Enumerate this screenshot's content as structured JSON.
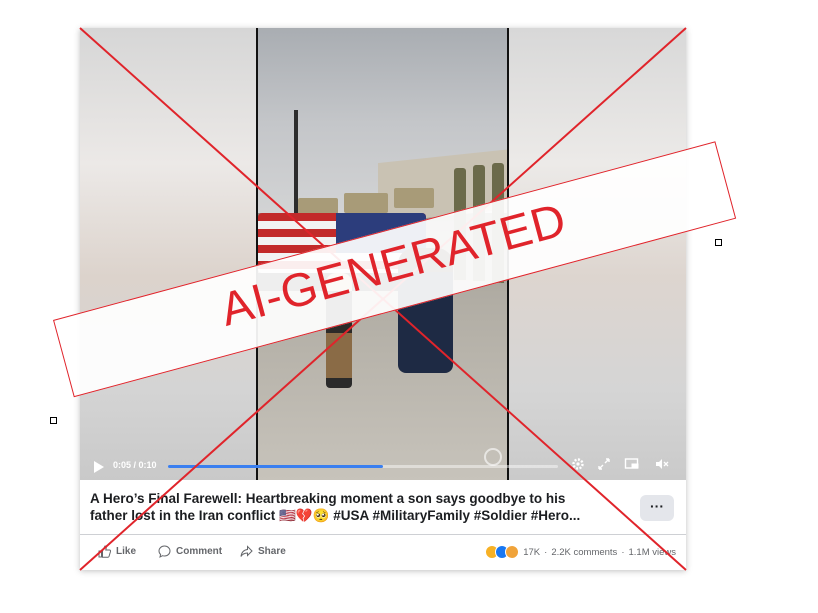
{
  "video": {
    "time": "0:05 / 0:10",
    "progress_fraction": 0.55,
    "icons": [
      "play-icon",
      "settings-icon",
      "fullscreen-icon",
      "pip-icon",
      "mute-icon"
    ]
  },
  "post": {
    "caption_line1": "A Hero’s Final Farewell: Heartbreaking moment a son says goodbye to his",
    "caption_line2": "father lost in the Iran conflict 🇺🇸💔🥺 #USA #MilitaryFamily #Soldier #Hero...",
    "more_label": "···"
  },
  "actions": {
    "like_label": "Like",
    "comment_label": "Comment",
    "share_label": "Share"
  },
  "stats": {
    "reactions_count": "17K",
    "comments": "2.2K comments",
    "separator": "·",
    "views": "1.1M views"
  },
  "stamp": {
    "label": "AI-GENERATED",
    "color": "#e0242b"
  },
  "colors": {
    "progress": "#3a7ff0",
    "like_reaction": "#1877f2",
    "sad_reaction": "#f7b125"
  }
}
